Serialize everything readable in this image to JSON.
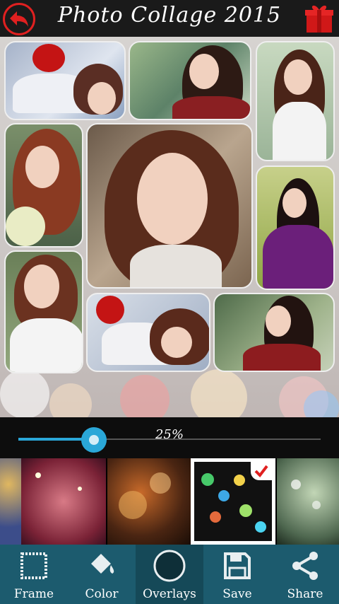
{
  "header": {
    "title": "Photo Collage 2015",
    "back_icon": "back-arrow-icon",
    "gift_icon": "gift-icon",
    "accent": "#e02020"
  },
  "slider": {
    "percent_label": "25%",
    "value": 0.25,
    "color": "#2aa7d8"
  },
  "overlays": {
    "selected_index": 2,
    "thumbnails": [
      "overlay-1",
      "overlay-2",
      "overlay-3",
      "overlay-4"
    ]
  },
  "toolbar": {
    "bg": "#1c5b6e",
    "items": [
      {
        "label": "Frame",
        "icon": "frame-icon"
      },
      {
        "label": "Color",
        "icon": "paint-bucket-icon"
      },
      {
        "label": "Overlays",
        "icon": "overlay-circle-icon"
      },
      {
        "label": "Save",
        "icon": "floppy-disk-icon"
      },
      {
        "label": "Share",
        "icon": "share-icon"
      }
    ]
  }
}
